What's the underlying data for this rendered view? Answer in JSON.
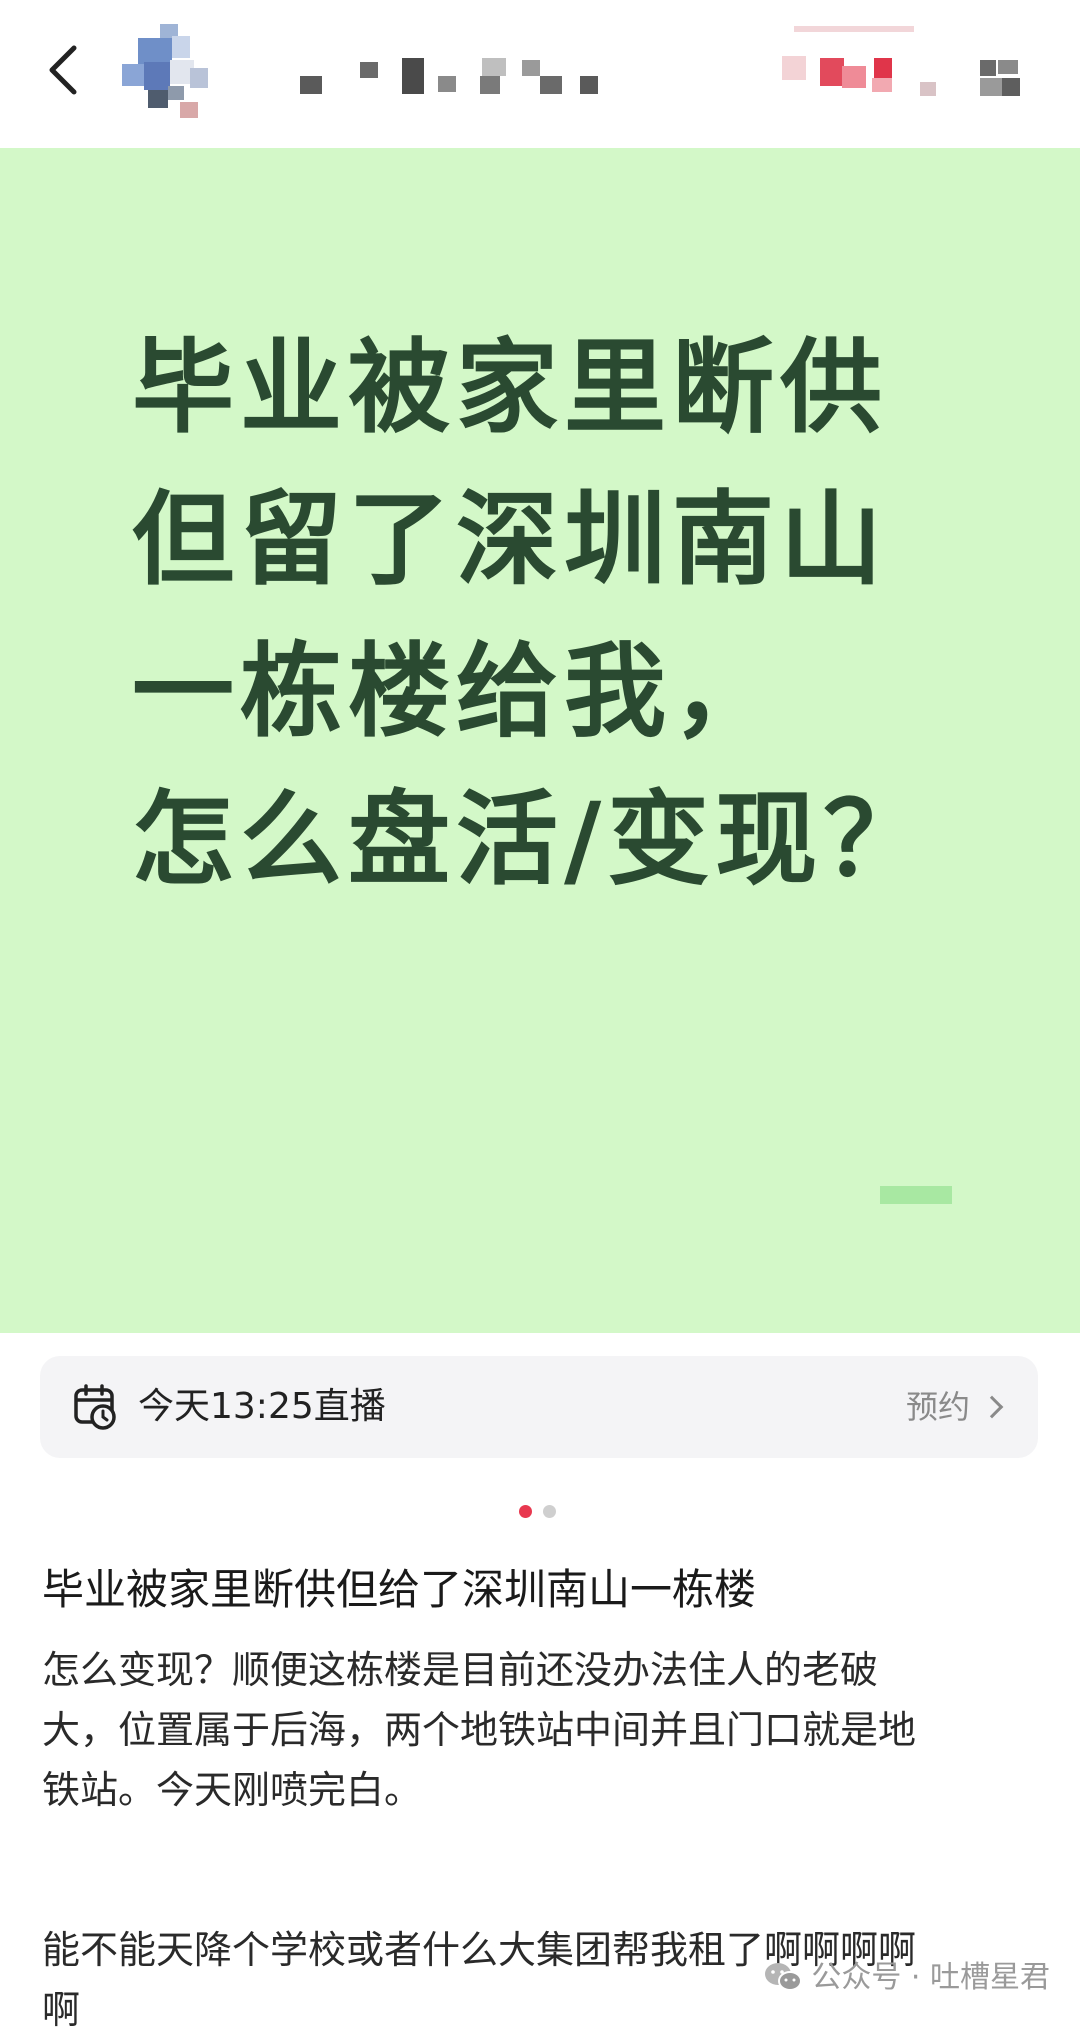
{
  "header": {
    "back_icon": "chevron-left-icon"
  },
  "hero": {
    "line1": "毕业被家里断供",
    "line2_pre": "但留了",
    "line2_highlight": "深圳南山",
    "line3": "一栋楼给我，",
    "line4": "怎么盘活/变现？",
    "colors": {
      "background": "#d3f8c8",
      "text": "#2a4a31",
      "highlight": "#f7c85d"
    }
  },
  "live": {
    "icon": "calendar-clock-icon",
    "text": "今天13:25直播",
    "action": "预约"
  },
  "carousel": {
    "active_index": 0,
    "count": 2,
    "colors": {
      "active": "#e8384f",
      "inactive": "#cfcfcf"
    }
  },
  "post": {
    "title": "毕业被家里断供但给了深圳南山一栋楼",
    "body_lines": [
      "怎么变现？顺便这栋楼是目前还没办法住人的老破",
      "大，位置属于后海，两个地铁站中间并且门口就是地",
      "铁站。今天刚喷完白。",
      "能不能天降个学校或者什么大集团帮我租了啊啊啊啊",
      "啊"
    ]
  },
  "watermark": {
    "icon": "wechat-icon",
    "text": "公众号 · 吐槽星君"
  }
}
